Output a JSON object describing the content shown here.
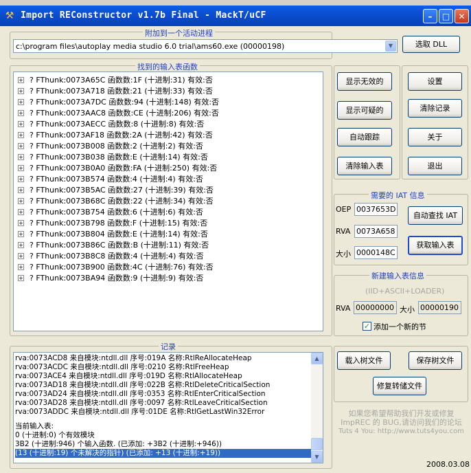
{
  "window": {
    "title": "Import REConstructor v1.7b Final - MackT/uCF"
  },
  "attach": {
    "group_label": "附加到一个活动进程",
    "process": "c:\\program files\\autoplay media studio 6.0 trial\\ams60.exe (00000198)",
    "pick_dll": "选取 DLL"
  },
  "imports": {
    "group_label": "找到的输入表函数",
    "rows": [
      "? FThunk:0073A65C 函数数:1F (十进制:31) 有效:否",
      "? FThunk:0073A718 函数数:21 (十进制:33) 有效:否",
      "? FThunk:0073A7DC 函数数:94 (十进制:148) 有效:否",
      "? FThunk:0073AAC8 函数数:CE (十进制:206) 有效:否",
      "? FThunk:0073AECC 函数数:8 (十进制:8) 有效:否",
      "? FThunk:0073AF18 函数数:2A (十进制:42) 有效:否",
      "? FThunk:0073B008 函数数:2 (十进制:2) 有效:否",
      "? FThunk:0073B038 函数数:E (十进制:14) 有效:否",
      "? FThunk:0073B0A0 函数数:FA (十进制:250) 有效:否",
      "? FThunk:0073B574 函数数:4 (十进制:4) 有效:否",
      "? FThunk:0073B5AC 函数数:27 (十进制:39) 有效:否",
      "? FThunk:0073B68C 函数数:22 (十进制:34) 有效:否",
      "? FThunk:0073B754 函数数:6 (十进制:6) 有效:否",
      "? FThunk:0073B798 函数数:F (十进制:15) 有效:否",
      "? FThunk:0073B804 函数数:E (十进制:14) 有效:否",
      "? FThunk:0073B86C 函数数:B (十进制:11) 有效:否",
      "? FThunk:0073B8C8 函数数:4 (十进制:4) 有效:否",
      "? FThunk:0073B900 函数数:4C (十进制:76) 有效:否",
      "? FThunk:0073BA94 函数数:9 (十进制:9) 有效:否"
    ]
  },
  "buttons": {
    "show_invalid": "显示无效的",
    "show_suspect": "显示可疑的",
    "auto_trace": "自动跟踪",
    "clear_imports": "清除输入表",
    "options": "设置",
    "clear_log": "清除记录",
    "about": "关于",
    "exit": "退出"
  },
  "iat": {
    "group_label": "需要的 IAT 信息",
    "oep_label": "OEP",
    "oep": "0037653D",
    "rva_label": "RVA",
    "rva": "0073A658",
    "size_label": "大小",
    "size": "0000148C",
    "iat_autosearch": "自动查找 IAT",
    "get_imports": "获取输入表"
  },
  "new_import": {
    "group_label": "新建输入表信息",
    "subtitle": "(IID+ASCII+LOADER)",
    "rva_label": "RVA",
    "rva": "00000000",
    "size_label": "大小",
    "size": "00000190",
    "add_section_label": "添加一个新的节",
    "add_section_checked": true
  },
  "log": {
    "group_label": "记录",
    "lines": [
      "rva:0073ACD8 来自模块:ntdll.dll 序号:019A 名称:RtlReAllocateHeap",
      "rva:0073ACDC 来自模块:ntdll.dll 序号:0210 名称:RtlFreeHeap",
      "rva:0073ACE4 来自模块:ntdll.dll 序号:019D 名称:RtlAllocateHeap",
      "rva:0073AD18 来自模块:ntdll.dll 序号:022B 名称:RtlDeleteCriticalSection",
      "rva:0073AD24 来自模块:ntdll.dll 序号:0353 名称:RtlEnterCriticalSection",
      "rva:0073AD28 来自模块:ntdll.dll 序号:0097 名称:RtlLeaveCriticalSection",
      "rva:0073ADDC 来自模块:ntdll.dll 序号:01DE 名称:RtlGetLastWin32Error",
      "当前输入表:",
      "0 (十进制:0) 个有效模块",
      "3B2 (十进制:946) 个输入函数. (已添加: +3B2 (十进制:+946))",
      "(13 (十进制:19) 个未解决的指针) (已添加: +13 (十进制:+19))"
    ]
  },
  "tree_actions": {
    "load_tree": "载入树文件",
    "save_tree": "保存树文件",
    "fix_dump": "修复转储文件"
  },
  "footer": {
    "note_line1": "如果您希望帮助我们开发或修复",
    "note_line2": "ImpREC 的 BUG,请访问我们的论坛",
    "note_line3": "Tuts 4 You: http://www.tuts4you.com",
    "date": "2008.03.08"
  },
  "colors": {
    "title_bar": "#0b4fd1",
    "group_label": "#1f3fc0",
    "selection": "#316ac5",
    "window_bg": "#ece9d8"
  }
}
